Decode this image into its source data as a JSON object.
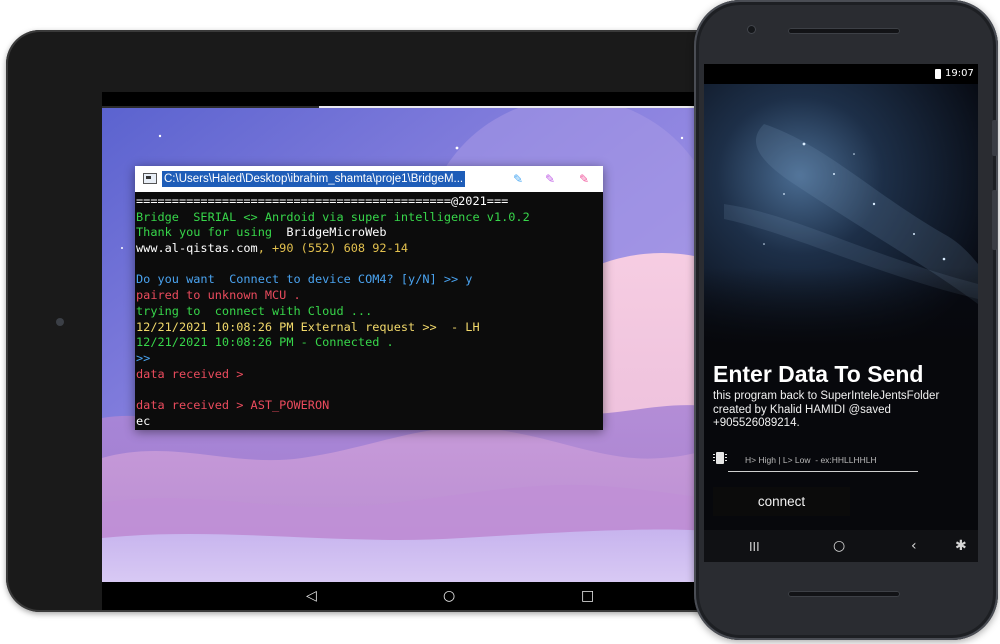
{
  "tablet": {
    "console": {
      "title": "C:\\Users\\Haled\\Desktop\\ibrahim_shamta\\proje1\\BridgeM...",
      "lines": [
        {
          "text": "============================================@2021===",
          "color": "#ffffff"
        },
        {
          "text": "Bridge  SERIAL <> Anrdoid via super intelligence v1.0.2",
          "color": "#37d64a"
        },
        {
          "text": "Thank you for using  ",
          "color": "#37d64a",
          "text2": "BridgeMicroWeb",
          "color2": "#ffffff"
        },
        {
          "text": "www.al-qistas.com",
          "color": "#ffffff",
          "text2": ", +90 (552) 608 92-14",
          "color2": "#e2c04e"
        },
        {
          "text": "",
          "color": "#ffffff"
        },
        {
          "text": "Do you want  Connect to device COM4? [y/N] >> y",
          "color": "#4aa3f0"
        },
        {
          "text": "paired to unknown MCU .",
          "color": "#ea4b5d"
        },
        {
          "text": "trying to  connect with Cloud ...",
          "color": "#37d64a"
        },
        {
          "text": "12/21/2021 10:08:26 PM External request >>  - LH",
          "color": "#f2d96b"
        },
        {
          "text": "12/21/2021 10:08:26 PM - Connected .",
          "color": "#37d64a"
        },
        {
          "text": ">>",
          "color": "#4aa3f0"
        },
        {
          "text": "data received >",
          "color": "#ea4b5d"
        },
        {
          "text": "",
          "color": "#ffffff"
        },
        {
          "text": "data received > AST_POWERON",
          "color": "#ea4b5d"
        },
        {
          "text": "ec",
          "color": "#ffffff"
        }
      ]
    },
    "nav": {
      "back_icon": "back-triangle-icon",
      "home_icon": "home-circle-icon",
      "recents_icon": "recents-square-icon"
    }
  },
  "phone": {
    "status_time": "19:07",
    "title": "Enter Data To Send",
    "description": "this program back to SuperInteleJentsFolder created by Khalid HAMIDI @saved +905526089214.",
    "input_placeholder": "H> High | L> Low  - ex:HHLLHHLH",
    "connect_label": "connect"
  },
  "colors": {
    "accent_blue": "#1e5db8",
    "console_bg": "#0c0c0c"
  }
}
